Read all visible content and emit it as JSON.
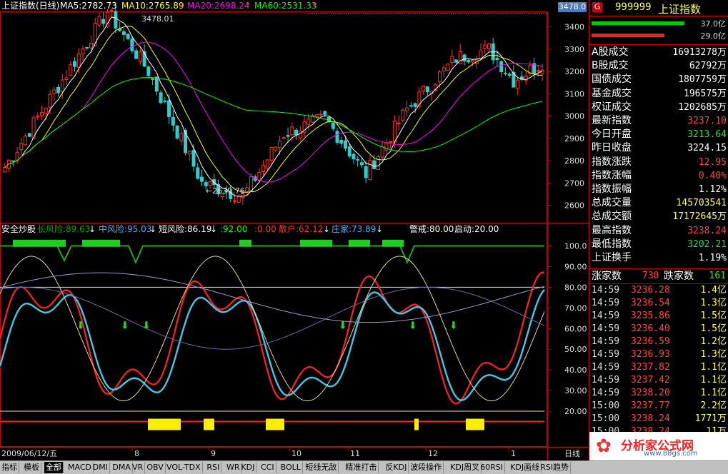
{
  "chart_header": {
    "title": "上证指数(日线)",
    "ma5": "MA5:2782.73",
    "ma10": "MA10:2765.89",
    "ma10_arrow": "↑",
    "ma20": "MA20:2698.24",
    "ma20_arrow": "↑",
    "ma60": "MA60:2531.33",
    "ma60_arrow": "↑",
    "price_tag": "3478.0",
    "colors": {
      "ma5": "#ffffff",
      "ma10": "#ffff00",
      "ma20": "#ff00ff",
      "ma60": "#00ff00"
    }
  },
  "price_annotations": {
    "high": "3478.01",
    "low": "←2639.76"
  },
  "price_axis": [
    "3400",
    "3300",
    "3200",
    "3100",
    "3000",
    "2900",
    "2800",
    "2700",
    "2600"
  ],
  "indicator_header": {
    "name": "安全炒股",
    "long_risk": "长风险:89.63",
    "long_arrow": "↓",
    "mid_risk": "中风险:95.03",
    "mid_arrow": "↓",
    "short_risk": "短风险:86.19",
    "short_arrow": "↓",
    "v1": ":92.00",
    "v2": ":0.00",
    "retail": "散户:62.12",
    "retail_arrow": "↓",
    "dealer": "庄家:73.89",
    "dealer_arrow": "↓",
    "alert": "警戒:80.00",
    "start": "启动:20.00"
  },
  "indicator_axis": [
    "100.0",
    "90.00",
    "80.00",
    "70.00",
    "60.00",
    "50.00",
    "40.00",
    "30.00",
    "20.00"
  ],
  "date_axis": {
    "date": "2009/06/12/五",
    "months": [
      "8",
      "9",
      "10",
      "11",
      "12",
      "1"
    ],
    "period": "日线"
  },
  "right_panel": {
    "code": "999999",
    "name": "上证指数",
    "flag": "G",
    "bar1_pct": "37.0亿",
    "bar2_pct": "29.0亿",
    "stats": [
      {
        "label": "A股成交",
        "value": "16913278万",
        "color": "#ffffff"
      },
      {
        "label": "B股成交",
        "value": "62792万",
        "color": "#ffffff"
      },
      {
        "label": "国债成交",
        "value": "1807759万",
        "color": "#ffffff"
      },
      {
        "label": "基金成交",
        "value": "196575万",
        "color": "#ffffff"
      },
      {
        "label": "权证成交",
        "value": "1202685万",
        "color": "#ffffff"
      },
      {
        "label": "最新指数",
        "value": "3237.10",
        "color": "#ff4444"
      },
      {
        "label": "今日开盘",
        "value": "3213.64",
        "color": "#33dd33"
      },
      {
        "label": "昨日收盘",
        "value": "3224.15",
        "color": "#ffffff"
      },
      {
        "label": "指数涨跌",
        "value": "12.95",
        "color": "#ff4444"
      },
      {
        "label": "指数涨幅",
        "value": "0.40%",
        "color": "#ff4444"
      },
      {
        "label": "指数振幅",
        "value": "1.12%",
        "color": "#ffffff"
      },
      {
        "label": "总成交量",
        "value": "145703541",
        "color": "#ffff55"
      },
      {
        "label": "总成交额",
        "value": "17172645万",
        "color": "#ffff55"
      },
      {
        "label": "最高指数",
        "value": "3238.24",
        "color": "#ff4444"
      },
      {
        "label": "最低指数",
        "value": "3202.21",
        "color": "#33dd33"
      },
      {
        "label": "上证换手",
        "value": "1.19%",
        "color": "#ffffff"
      }
    ],
    "rise_label": "涨家数",
    "rise_count": "730",
    "fall_label": "跌家数",
    "fall_count": "161",
    "ticks": [
      {
        "time": "14:59",
        "price": "3236.28",
        "vol": "1.4亿"
      },
      {
        "time": "14:59",
        "price": "3236.54",
        "vol": "1.3亿"
      },
      {
        "time": "14:59",
        "price": "3235.86",
        "vol": "1.5亿"
      },
      {
        "time": "14:59",
        "price": "3236.40",
        "vol": "1.5亿"
      },
      {
        "time": "14:59",
        "price": "3236.59",
        "vol": "1.2亿"
      },
      {
        "time": "14:59",
        "price": "3236.93",
        "vol": "1.3亿"
      },
      {
        "time": "14:59",
        "price": "3237.82",
        "vol": "1.1亿"
      },
      {
        "time": "14:59",
        "price": "3237.42",
        "vol": "1.1亿"
      },
      {
        "time": "14:59",
        "price": "3238.20",
        "vol": "1.1亿"
      },
      {
        "time": "15:00",
        "price": "3237.77",
        "vol": "2.2亿"
      },
      {
        "time": "15:00",
        "price": "3238.24",
        "vol": "1771万"
      },
      {
        "time": "15:00",
        "price": "3238.24",
        "vol": "11万"
      }
    ],
    "brand": "分析家公式网",
    "brand_url": "www.88gs.com"
  },
  "tabs": [
    "指标",
    "模板",
    "全部",
    "MACD",
    "DMI",
    "DMA",
    "VR",
    "OBV",
    "VOL-TDX",
    "RSI",
    "WR",
    "KDJ",
    "CCI",
    "BOLL",
    "短线无敌",
    "精准打击",
    "反KDJ",
    "波段操作",
    "KDJ周叉",
    "60RSI",
    "KDJ画线",
    "RSI趋势"
  ],
  "active_tab": "全部"
}
